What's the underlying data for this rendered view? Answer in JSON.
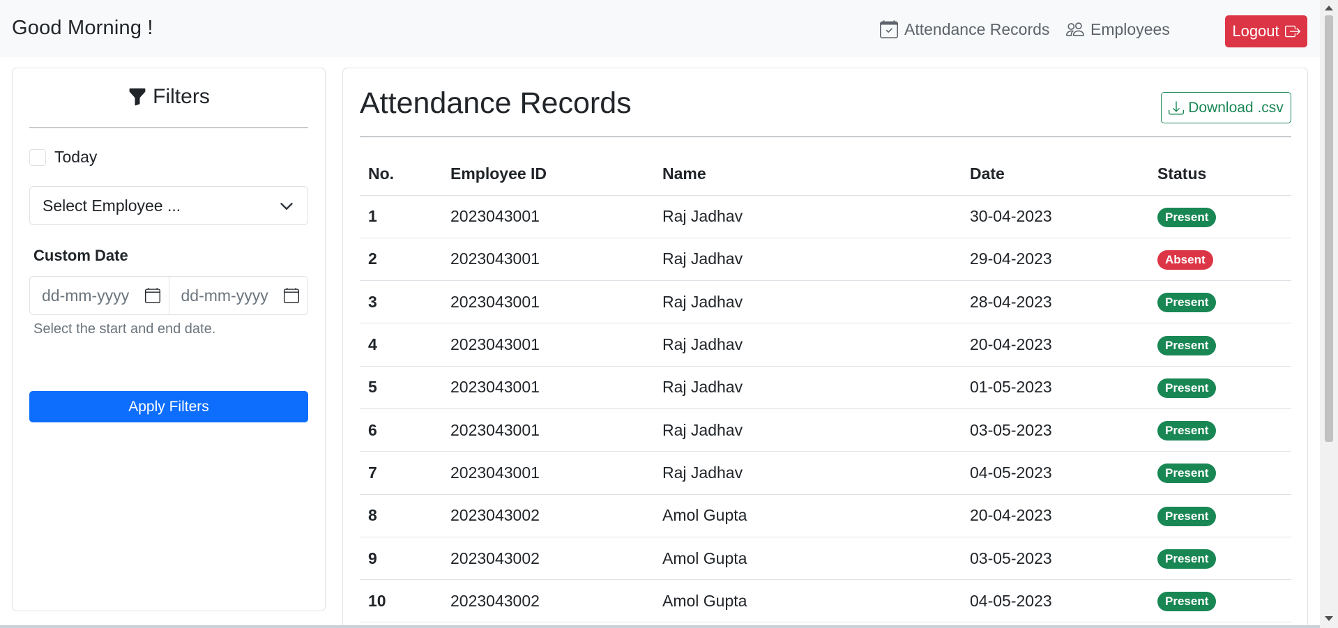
{
  "navbar": {
    "brand": "Good Morning !",
    "links": [
      {
        "label": "Attendance Records",
        "icon": "calendar-check-icon"
      },
      {
        "label": "Employees",
        "icon": "people-icon"
      }
    ],
    "logout_label": "Logout"
  },
  "filters": {
    "title": "Filters",
    "today_label": "Today",
    "select_employee_placeholder": "Select Employee ...",
    "custom_date_label": "Custom Date",
    "start_date_placeholder": "dd-mm-yyyy",
    "end_date_placeholder": "dd-mm-yyyy",
    "date_help": "Select the start and end date.",
    "apply_label": "Apply Filters"
  },
  "records": {
    "title": "Attendance Records",
    "download_label": "Download .csv",
    "columns": [
      "No.",
      "Employee ID",
      "Name",
      "Date",
      "Status"
    ],
    "rows": [
      {
        "no": "1",
        "id": "2023043001",
        "name": "Raj Jadhav",
        "date": "30-04-2023",
        "status": "Present"
      },
      {
        "no": "2",
        "id": "2023043001",
        "name": "Raj Jadhav",
        "date": "29-04-2023",
        "status": "Absent"
      },
      {
        "no": "3",
        "id": "2023043001",
        "name": "Raj Jadhav",
        "date": "28-04-2023",
        "status": "Present"
      },
      {
        "no": "4",
        "id": "2023043001",
        "name": "Raj Jadhav",
        "date": "20-04-2023",
        "status": "Present"
      },
      {
        "no": "5",
        "id": "2023043001",
        "name": "Raj Jadhav",
        "date": "01-05-2023",
        "status": "Present"
      },
      {
        "no": "6",
        "id": "2023043001",
        "name": "Raj Jadhav",
        "date": "03-05-2023",
        "status": "Present"
      },
      {
        "no": "7",
        "id": "2023043001",
        "name": "Raj Jadhav",
        "date": "04-05-2023",
        "status": "Present"
      },
      {
        "no": "8",
        "id": "2023043002",
        "name": "Amol Gupta",
        "date": "20-04-2023",
        "status": "Present"
      },
      {
        "no": "9",
        "id": "2023043002",
        "name": "Amol Gupta",
        "date": "03-05-2023",
        "status": "Present"
      },
      {
        "no": "10",
        "id": "2023043002",
        "name": "Amol Gupta",
        "date": "04-05-2023",
        "status": "Present"
      }
    ]
  },
  "colors": {
    "danger": "#dc3545",
    "success": "#198754",
    "primary": "#0d6efd",
    "navbar_bg": "#f8f9fa"
  }
}
